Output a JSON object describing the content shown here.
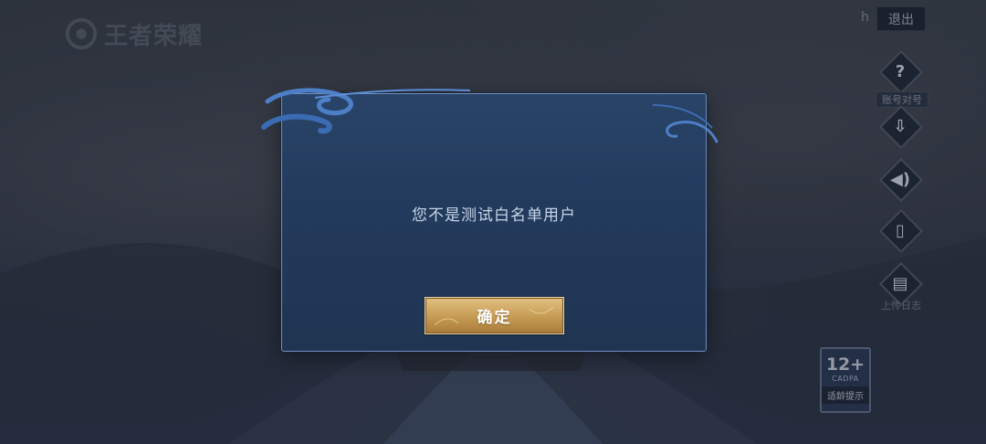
{
  "app": {
    "logo_text": "王者荣耀"
  },
  "header": {
    "user_initial": "h",
    "logout_label": "退出"
  },
  "side_menu": {
    "items": [
      {
        "icon": "help-icon",
        "glyph": "?",
        "label": "账号对号"
      },
      {
        "icon": "download-icon",
        "glyph": "⇩",
        "label": ""
      },
      {
        "icon": "speaker-icon",
        "glyph": "◀)",
        "label": ""
      },
      {
        "icon": "device-icon",
        "glyph": "▯",
        "label": ""
      },
      {
        "icon": "clipboard-icon",
        "glyph": "▤",
        "label": "上传日志"
      }
    ]
  },
  "age_rating": {
    "number": "12+",
    "org": "CADPA",
    "tip": "适龄提示"
  },
  "dialog": {
    "message": "您不是测试白名单用户",
    "confirm_label": "确定"
  },
  "colors": {
    "dialog_bg": "#223a5c",
    "dialog_border": "#6f8fbf",
    "button_gold": "#c59a52",
    "message_text": "#c7d6ea"
  }
}
